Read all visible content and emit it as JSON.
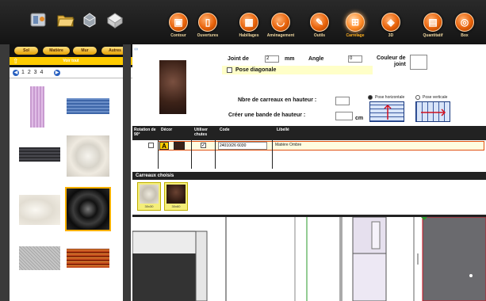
{
  "colors": {
    "accent_orange": "#e8620a",
    "active_label": "#ffb020",
    "yellow_panel": "#ffcc00",
    "header_dark": "#222222"
  },
  "toolbar": {
    "tools": [
      {
        "icon": "paint-palette-icon"
      },
      {
        "icon": "folder-open-icon"
      },
      {
        "icon": "paint-bucket-icon"
      },
      {
        "icon": "print-icon"
      }
    ],
    "nav": [
      {
        "label": "Contour",
        "icon": "contour-icon"
      },
      {
        "label": "Ouvertures",
        "icon": "door-icon"
      },
      {
        "label": "Habillages",
        "icon": "brick-icon"
      },
      {
        "label": "Aménagement",
        "icon": "bathtub-icon"
      },
      {
        "label": "Outils",
        "icon": "tools-icon"
      },
      {
        "label": "Carrelage",
        "icon": "tile-icon",
        "active": true
      },
      {
        "label": "3D",
        "icon": "cube-3d-icon"
      },
      {
        "label": "Quantitatif",
        "icon": "calculator-icon"
      },
      {
        "label": "Box",
        "icon": "box-icon"
      }
    ]
  },
  "filters": {
    "tabs": [
      "Sol",
      "Matière",
      "Mur",
      "Autres"
    ],
    "sub_label": "Voir tout",
    "pages": "1 2 3 4"
  },
  "form": {
    "joint_label": "Joint de",
    "joint_value": "2",
    "joint_unit": "mm",
    "angle_label": "Angle",
    "angle_value": "0",
    "color_label_1": "Couleur de",
    "color_label_2": "joint",
    "diagonal_label": "Pose diagonale",
    "rows_height_label": "Nbre de carreaux en hauteur :",
    "band_label": "Créer une bande de hauteur :",
    "band_unit": "cm",
    "pose_horizontal": "Pose horizontale",
    "pose_vertical": "Pose verticale"
  },
  "table": {
    "headers": [
      "Rotation de 90°",
      "Décor",
      "Utiliser chutes",
      "Code",
      "Libellé"
    ],
    "row": {
      "decor": "A",
      "code": "24010/26 6030",
      "label": "Matière Ombre"
    }
  },
  "chosen": {
    "title": "Carreaux choisis",
    "tiles": [
      {
        "caption": "30x30"
      },
      {
        "caption": "30x60"
      }
    ]
  }
}
